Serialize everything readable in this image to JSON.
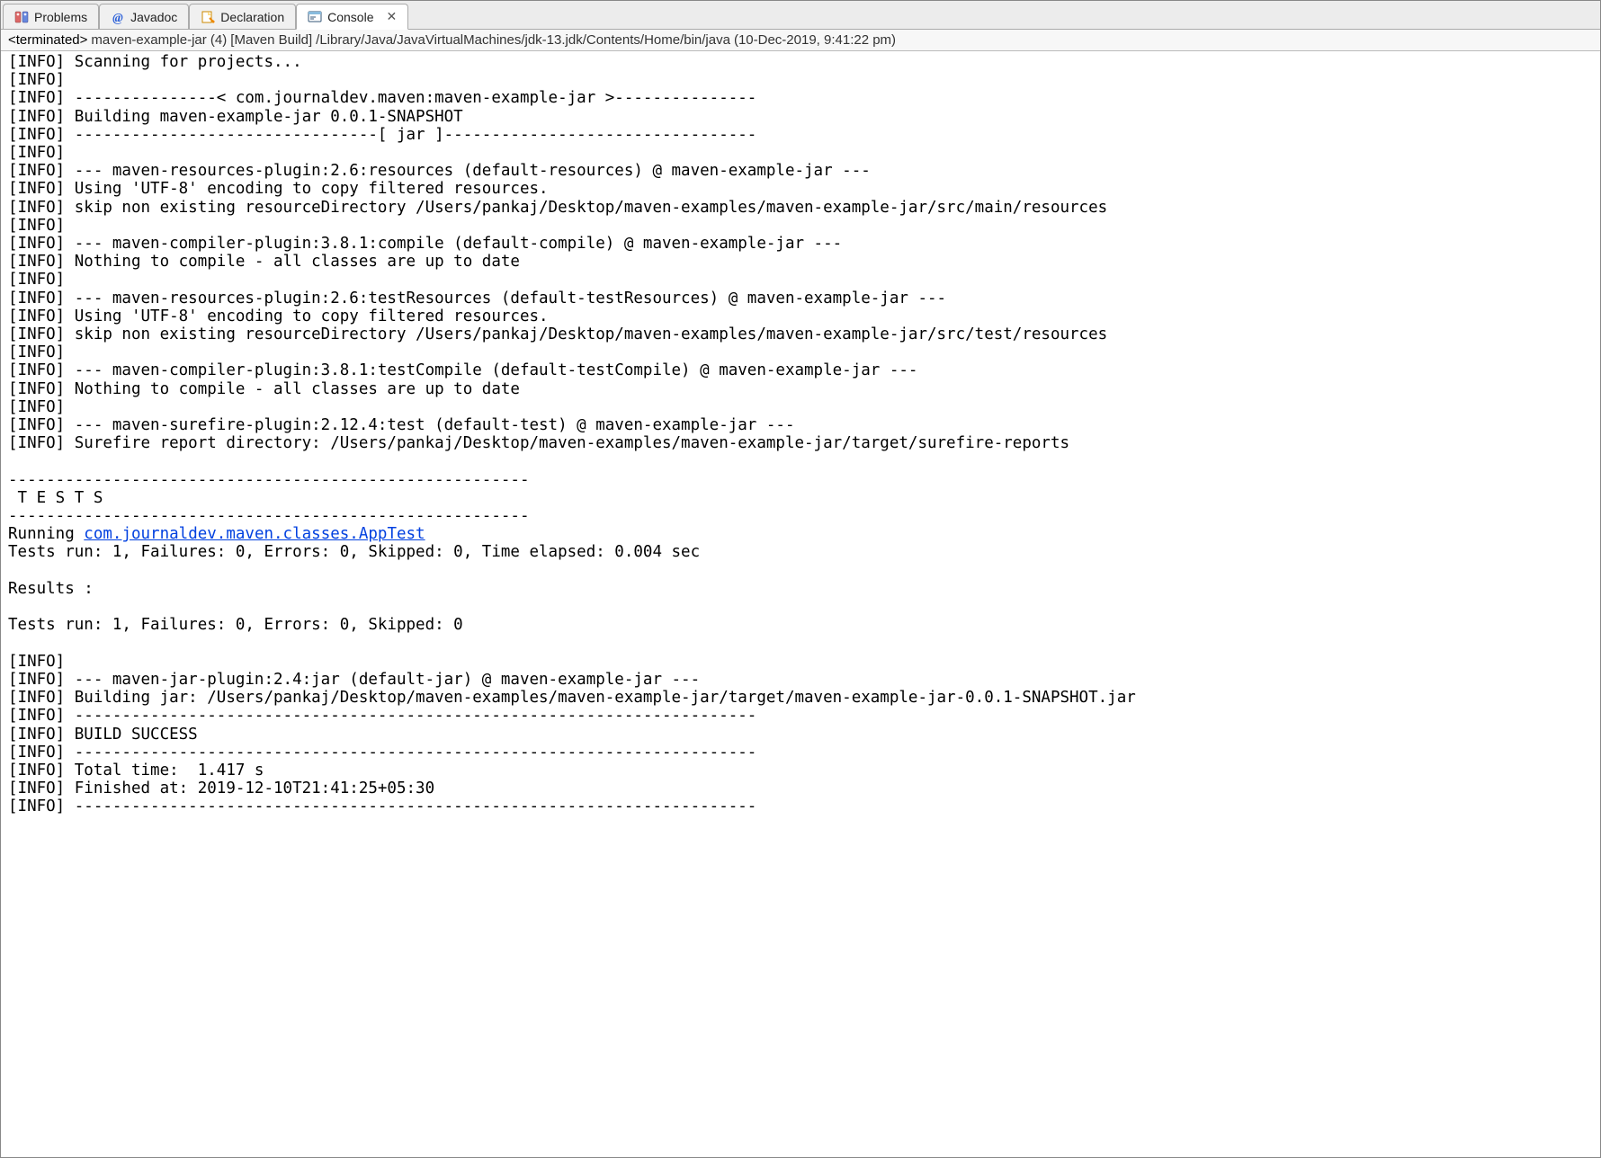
{
  "tabs": {
    "problems": {
      "label": "Problems"
    },
    "javadoc": {
      "label": "Javadoc"
    },
    "declaration": {
      "label": "Declaration"
    },
    "console": {
      "label": "Console"
    }
  },
  "status": {
    "terminated": "<terminated>",
    "run_name": "maven-example-jar (4)",
    "run_type": "[Maven Build]",
    "path": "/Library/Java/JavaVirtualMachines/jdk-13.jdk/Contents/Home/bin/java",
    "timestamp": "(10-Dec-2019, 9:41:22 pm)"
  },
  "console_link": {
    "prefix": "Running ",
    "text": "com.journaldev.maven.classes.AppTest"
  },
  "console_pre": "[INFO] Scanning for projects...\n[INFO] \n[INFO] ---------------< com.journaldev.maven:maven-example-jar >---------------\n[INFO] Building maven-example-jar 0.0.1-SNAPSHOT\n[INFO] --------------------------------[ jar ]---------------------------------\n[INFO] \n[INFO] --- maven-resources-plugin:2.6:resources (default-resources) @ maven-example-jar ---\n[INFO] Using 'UTF-8' encoding to copy filtered resources.\n[INFO] skip non existing resourceDirectory /Users/pankaj/Desktop/maven-examples/maven-example-jar/src/main/resources\n[INFO] \n[INFO] --- maven-compiler-plugin:3.8.1:compile (default-compile) @ maven-example-jar ---\n[INFO] Nothing to compile - all classes are up to date\n[INFO] \n[INFO] --- maven-resources-plugin:2.6:testResources (default-testResources) @ maven-example-jar ---\n[INFO] Using 'UTF-8' encoding to copy filtered resources.\n[INFO] skip non existing resourceDirectory /Users/pankaj/Desktop/maven-examples/maven-example-jar/src/test/resources\n[INFO] \n[INFO] --- maven-compiler-plugin:3.8.1:testCompile (default-testCompile) @ maven-example-jar ---\n[INFO] Nothing to compile - all classes are up to date\n[INFO] \n[INFO] --- maven-surefire-plugin:2.12.4:test (default-test) @ maven-example-jar ---\n[INFO] Surefire report directory: /Users/pankaj/Desktop/maven-examples/maven-example-jar/target/surefire-reports\n\n-------------------------------------------------------\n T E S T S\n-------------------------------------------------------\n",
  "console_post": "\nTests run: 1, Failures: 0, Errors: 0, Skipped: 0, Time elapsed: 0.004 sec\n\nResults :\n\nTests run: 1, Failures: 0, Errors: 0, Skipped: 0\n\n[INFO] \n[INFO] --- maven-jar-plugin:2.4:jar (default-jar) @ maven-example-jar ---\n[INFO] Building jar: /Users/pankaj/Desktop/maven-examples/maven-example-jar/target/maven-example-jar-0.0.1-SNAPSHOT.jar\n[INFO] ------------------------------------------------------------------------\n[INFO] BUILD SUCCESS\n[INFO] ------------------------------------------------------------------------\n[INFO] Total time:  1.417 s\n[INFO] Finished at: 2019-12-10T21:41:25+05:30\n[INFO] ------------------------------------------------------------------------"
}
